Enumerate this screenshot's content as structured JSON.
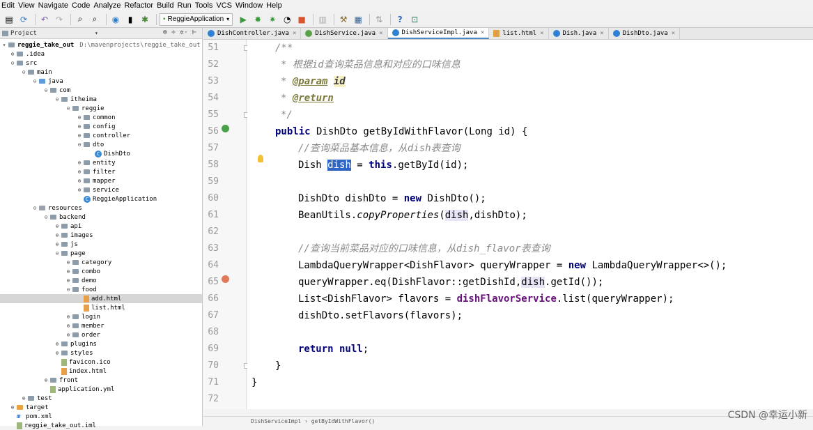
{
  "menu": [
    "Edit",
    "View",
    "Navigate",
    "Code",
    "Analyze",
    "Refactor",
    "Build",
    "Run",
    "Tools",
    "VCS",
    "Window",
    "Help"
  ],
  "toolbar": {
    "run_config": "ReggieApplication"
  },
  "project": {
    "header": "Project",
    "root": "reggie_take_out",
    "root_path": "D:\\mavenprojects\\reggie_take_out",
    "items": [
      ".idea",
      "src",
      "main",
      "java",
      "com",
      "itheima",
      "reggie",
      "common",
      "config",
      "controller",
      "dto",
      "DishDto",
      "entity",
      "filter",
      "mapper",
      "service",
      "ReggieApplication",
      "resources",
      "backend",
      "api",
      "images",
      "js",
      "page",
      "category",
      "combo",
      "demo",
      "food",
      "add.html",
      "list.html",
      "login",
      "member",
      "order",
      "plugins",
      "styles",
      "favicon.ico",
      "index.html",
      "front",
      "application.yml",
      "test",
      "target",
      "pom.xml",
      "reggie_take_out.iml"
    ]
  },
  "tabs": [
    "DishController.java",
    "DishService.java",
    "DishServiceImpl.java",
    "list.html",
    "Dish.java",
    "DishDto.java"
  ],
  "active_tab": "DishServiceImpl.java",
  "lines": [
    "51",
    "52",
    "53",
    "54",
    "55",
    "56",
    "57",
    "58",
    "59",
    "60",
    "61",
    "62",
    "63",
    "64",
    "65",
    "66",
    "67",
    "68",
    "69",
    "70",
    "71",
    "72"
  ],
  "code": {
    "l51": "/**",
    "l52": "* 根据id查询菜品信息和对应的口味信息",
    "l53a": "* ",
    "l53b": "@param",
    "l53c": "id",
    "l54a": "* ",
    "l54b": "@return",
    "l55": "*/",
    "l56a": "public",
    "l56b": " DishDto getByIdWithFlavor(Long id) {",
    "l57": "//查询菜品基本信息，从dish表查询",
    "l58a": "Dish ",
    "l58b": "dish",
    "l58c": " = ",
    "l58d": "this",
    "l58e": ".getById(id);",
    "l60a": "DishDto dishDto = ",
    "l60b": "new",
    "l60c": " DishDto();",
    "l61a": "BeanUtils.",
    "l61b": "copyProperties",
    "l61c": "(",
    "l61d": "dish",
    "l61e": ",dishDto);",
    "l63": "//查询当前菜品对应的口味信息，从dish_flavor表查询",
    "l64a": "LambdaQueryWrapper<DishFlavor> queryWrapper = ",
    "l64b": "new",
    "l64c": " LambdaQueryWrapper<>();",
    "l65a": "queryWrapper.eq(DishFlavor::getDishId,",
    "l65b": "dish",
    "l65c": ".getId());",
    "l66a": "List<DishFlavor> flavors = ",
    "l66b": "dishFlavorService",
    "l66c": ".list(queryWrapper);",
    "l67": "dishDto.setFlavors(flavors);",
    "l69a": "return",
    "l69b": " null",
    "l69c": ";",
    "l70": "}",
    "l71": "}"
  },
  "breadcrumb": {
    "class": "DishServiceImpl",
    "method": "getByIdWithFlavor()"
  },
  "watermark": "CSDN @幸运小新"
}
